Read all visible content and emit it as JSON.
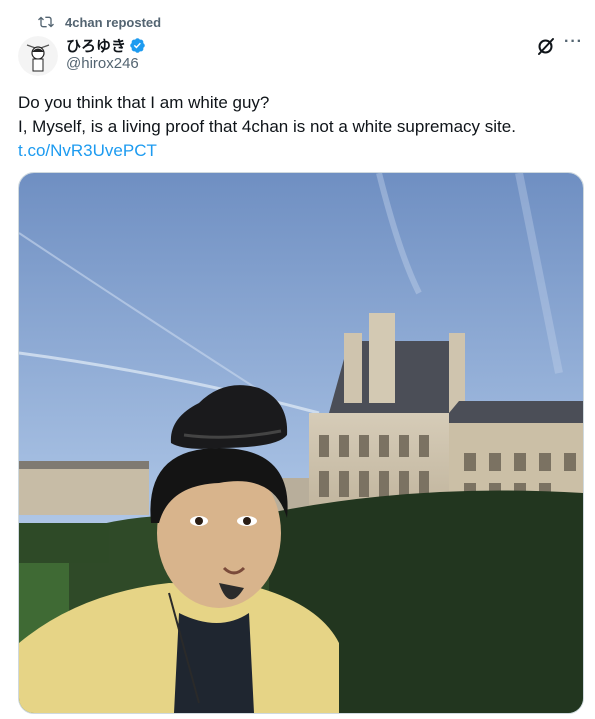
{
  "repost": {
    "icon": "repost-icon",
    "label": "4chan reposted"
  },
  "author": {
    "name": "ひろゆき",
    "handle": "@hirox246",
    "verified_icon": "verified-badge-icon",
    "avatar_icon": "avatar"
  },
  "actions": {
    "grok_icon": "grok-icon",
    "more_label": "···"
  },
  "post": {
    "line1": "Do you think that I am white guy?",
    "line2": "I, Myself, is a living proof that 4chan is not a white supremacy site.",
    "link": "t.co/NvR3UvePCT"
  },
  "media": {
    "description_icon": "photo"
  },
  "colors": {
    "accent": "#1d9bf0",
    "secondary_text": "#536471",
    "border": "#cfd9de"
  }
}
